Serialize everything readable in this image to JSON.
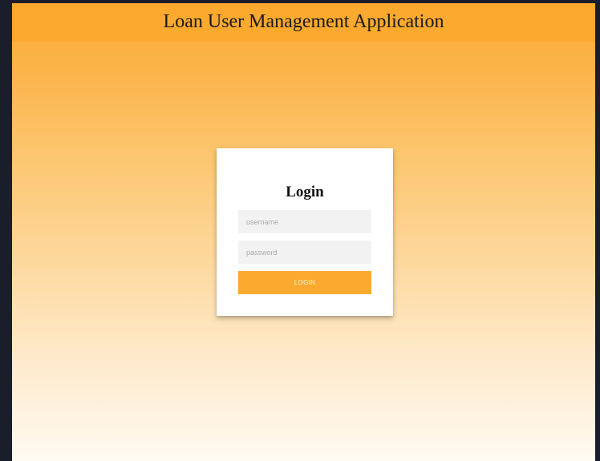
{
  "header": {
    "title": "Loan User Management Application"
  },
  "login": {
    "title": "Login",
    "username_placeholder": "username",
    "password_placeholder": "password",
    "button_label": "LOGIN"
  },
  "colors": {
    "accent": "#fba92f",
    "card": "#ffffff",
    "field_bg": "#f2f2f2",
    "frame": "#1a1e2a"
  }
}
